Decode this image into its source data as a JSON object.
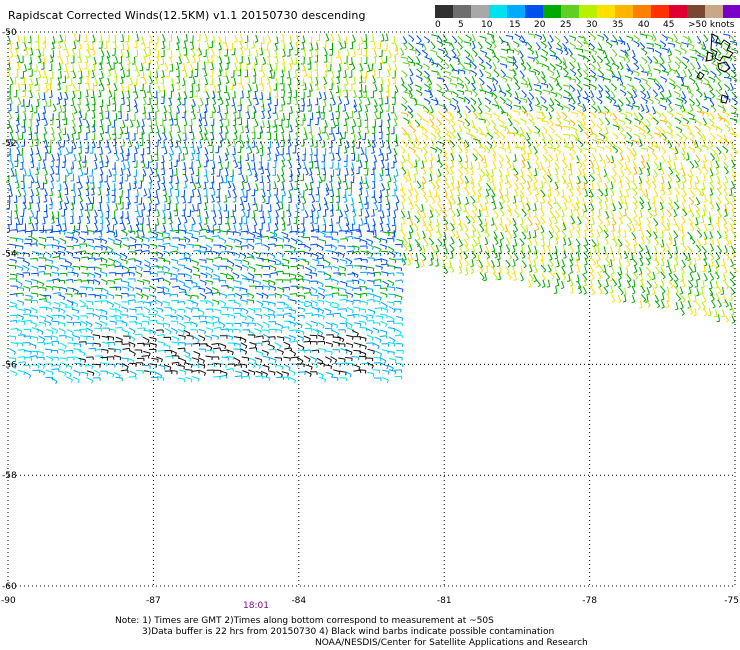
{
  "title": "Rapidscat Corrected Winds(12.5KM) v1.1 20150730 descending",
  "legend": {
    "colors": [
      "#303030",
      "#6e6e6e",
      "#a8a8a8",
      "#00e1f0",
      "#00aaff",
      "#0050f0",
      "#00aa00",
      "#60d020",
      "#b8f000",
      "#ffe000",
      "#ffb400",
      "#ff8000",
      "#ff3000",
      "#e00030",
      "#7a4830",
      "#c8a888",
      "#7a00c8",
      "#3c0078"
    ],
    "labels": [
      "0",
      "5",
      "10",
      "15",
      "20",
      "25",
      "30",
      "35",
      "40",
      "45",
      ">50 knots"
    ]
  },
  "axes": {
    "x_ticks": [
      "-90",
      "-87",
      "-84",
      "-81",
      "-78",
      "-75"
    ],
    "y_ticks": [
      "-50",
      "-52",
      "-54",
      "-56",
      "-58",
      "-60"
    ],
    "lon_range": [
      -90,
      -75
    ],
    "lat_range": [
      -60,
      -50
    ]
  },
  "time_label": "18:01",
  "notes": [
    "Note: 1) Times are GMT 2)Times along bottom correspond to measurement at ~50S",
    "3)Data buffer is 22 hrs from 20150730 4) Black wind barbs indicate possible contamination",
    "NOAA/NESDIS/Center for Satellite Applications and Research"
  ]
}
